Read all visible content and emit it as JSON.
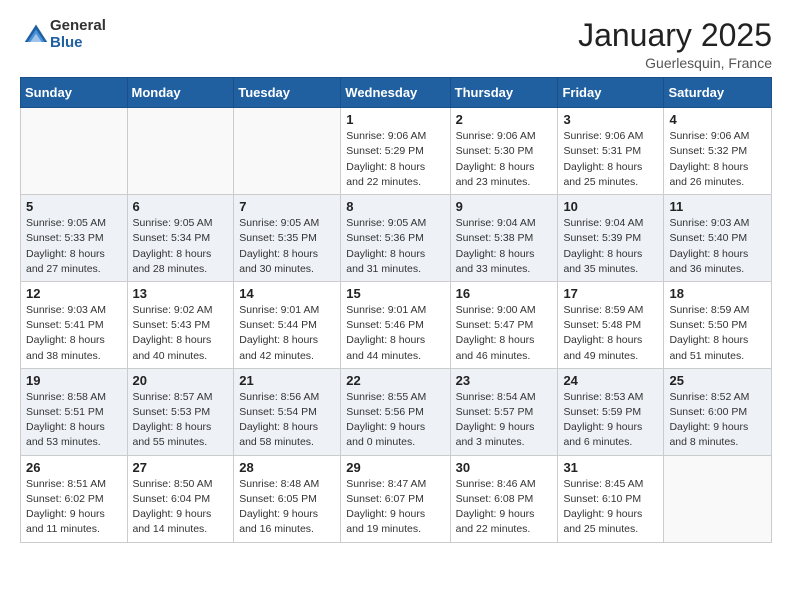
{
  "header": {
    "logo_general": "General",
    "logo_blue": "Blue",
    "title": "January 2025",
    "location": "Guerlesquin, France"
  },
  "days_of_week": [
    "Sunday",
    "Monday",
    "Tuesday",
    "Wednesday",
    "Thursday",
    "Friday",
    "Saturday"
  ],
  "weeks": [
    [
      {
        "day": "",
        "info": ""
      },
      {
        "day": "",
        "info": ""
      },
      {
        "day": "",
        "info": ""
      },
      {
        "day": "1",
        "info": "Sunrise: 9:06 AM\nSunset: 5:29 PM\nDaylight: 8 hours\nand 22 minutes."
      },
      {
        "day": "2",
        "info": "Sunrise: 9:06 AM\nSunset: 5:30 PM\nDaylight: 8 hours\nand 23 minutes."
      },
      {
        "day": "3",
        "info": "Sunrise: 9:06 AM\nSunset: 5:31 PM\nDaylight: 8 hours\nand 25 minutes."
      },
      {
        "day": "4",
        "info": "Sunrise: 9:06 AM\nSunset: 5:32 PM\nDaylight: 8 hours\nand 26 minutes."
      }
    ],
    [
      {
        "day": "5",
        "info": "Sunrise: 9:05 AM\nSunset: 5:33 PM\nDaylight: 8 hours\nand 27 minutes."
      },
      {
        "day": "6",
        "info": "Sunrise: 9:05 AM\nSunset: 5:34 PM\nDaylight: 8 hours\nand 28 minutes."
      },
      {
        "day": "7",
        "info": "Sunrise: 9:05 AM\nSunset: 5:35 PM\nDaylight: 8 hours\nand 30 minutes."
      },
      {
        "day": "8",
        "info": "Sunrise: 9:05 AM\nSunset: 5:36 PM\nDaylight: 8 hours\nand 31 minutes."
      },
      {
        "day": "9",
        "info": "Sunrise: 9:04 AM\nSunset: 5:38 PM\nDaylight: 8 hours\nand 33 minutes."
      },
      {
        "day": "10",
        "info": "Sunrise: 9:04 AM\nSunset: 5:39 PM\nDaylight: 8 hours\nand 35 minutes."
      },
      {
        "day": "11",
        "info": "Sunrise: 9:03 AM\nSunset: 5:40 PM\nDaylight: 8 hours\nand 36 minutes."
      }
    ],
    [
      {
        "day": "12",
        "info": "Sunrise: 9:03 AM\nSunset: 5:41 PM\nDaylight: 8 hours\nand 38 minutes."
      },
      {
        "day": "13",
        "info": "Sunrise: 9:02 AM\nSunset: 5:43 PM\nDaylight: 8 hours\nand 40 minutes."
      },
      {
        "day": "14",
        "info": "Sunrise: 9:01 AM\nSunset: 5:44 PM\nDaylight: 8 hours\nand 42 minutes."
      },
      {
        "day": "15",
        "info": "Sunrise: 9:01 AM\nSunset: 5:46 PM\nDaylight: 8 hours\nand 44 minutes."
      },
      {
        "day": "16",
        "info": "Sunrise: 9:00 AM\nSunset: 5:47 PM\nDaylight: 8 hours\nand 46 minutes."
      },
      {
        "day": "17",
        "info": "Sunrise: 8:59 AM\nSunset: 5:48 PM\nDaylight: 8 hours\nand 49 minutes."
      },
      {
        "day": "18",
        "info": "Sunrise: 8:59 AM\nSunset: 5:50 PM\nDaylight: 8 hours\nand 51 minutes."
      }
    ],
    [
      {
        "day": "19",
        "info": "Sunrise: 8:58 AM\nSunset: 5:51 PM\nDaylight: 8 hours\nand 53 minutes."
      },
      {
        "day": "20",
        "info": "Sunrise: 8:57 AM\nSunset: 5:53 PM\nDaylight: 8 hours\nand 55 minutes."
      },
      {
        "day": "21",
        "info": "Sunrise: 8:56 AM\nSunset: 5:54 PM\nDaylight: 8 hours\nand 58 minutes."
      },
      {
        "day": "22",
        "info": "Sunrise: 8:55 AM\nSunset: 5:56 PM\nDaylight: 9 hours\nand 0 minutes."
      },
      {
        "day": "23",
        "info": "Sunrise: 8:54 AM\nSunset: 5:57 PM\nDaylight: 9 hours\nand 3 minutes."
      },
      {
        "day": "24",
        "info": "Sunrise: 8:53 AM\nSunset: 5:59 PM\nDaylight: 9 hours\nand 6 minutes."
      },
      {
        "day": "25",
        "info": "Sunrise: 8:52 AM\nSunset: 6:00 PM\nDaylight: 9 hours\nand 8 minutes."
      }
    ],
    [
      {
        "day": "26",
        "info": "Sunrise: 8:51 AM\nSunset: 6:02 PM\nDaylight: 9 hours\nand 11 minutes."
      },
      {
        "day": "27",
        "info": "Sunrise: 8:50 AM\nSunset: 6:04 PM\nDaylight: 9 hours\nand 14 minutes."
      },
      {
        "day": "28",
        "info": "Sunrise: 8:48 AM\nSunset: 6:05 PM\nDaylight: 9 hours\nand 16 minutes."
      },
      {
        "day": "29",
        "info": "Sunrise: 8:47 AM\nSunset: 6:07 PM\nDaylight: 9 hours\nand 19 minutes."
      },
      {
        "day": "30",
        "info": "Sunrise: 8:46 AM\nSunset: 6:08 PM\nDaylight: 9 hours\nand 22 minutes."
      },
      {
        "day": "31",
        "info": "Sunrise: 8:45 AM\nSunset: 6:10 PM\nDaylight: 9 hours\nand 25 minutes."
      },
      {
        "day": "",
        "info": ""
      }
    ]
  ]
}
